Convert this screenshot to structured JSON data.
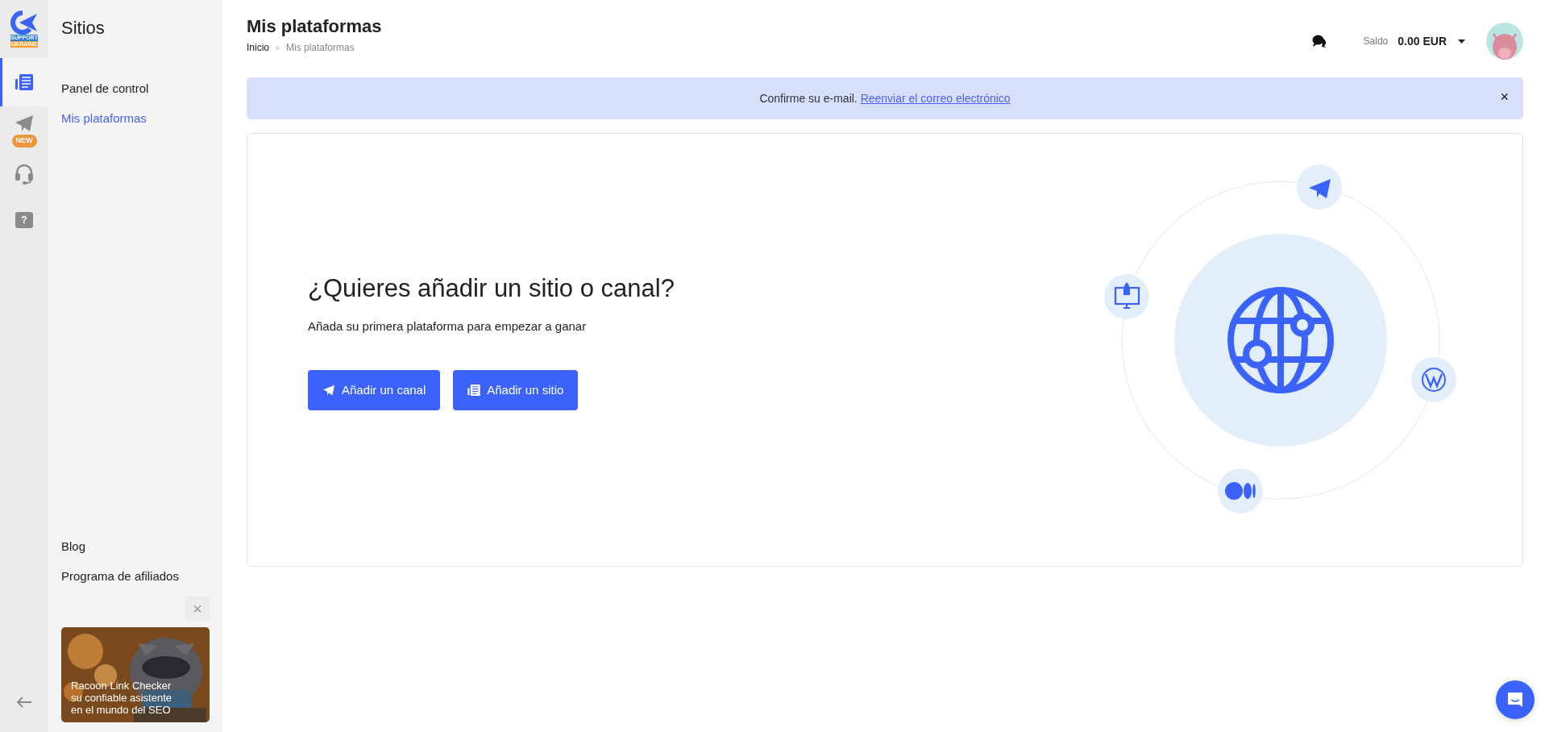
{
  "logo": {
    "badge_top": "SUPPORT",
    "badge_bottom": "UKRAINE"
  },
  "rail": [
    {
      "kind": "sites",
      "selected": true
    },
    {
      "kind": "telegram",
      "selected": false,
      "badge": "NEW"
    },
    {
      "kind": "support",
      "selected": false
    },
    {
      "kind": "help",
      "selected": false,
      "glyph": "?"
    }
  ],
  "sidebar": {
    "title": "Sitios",
    "items": [
      {
        "label": "Panel de control",
        "selected": false
      },
      {
        "label": "Mis plataformas",
        "selected": true
      }
    ],
    "footer_items": [
      {
        "label": "Blog"
      },
      {
        "label": "Programa de afiliados"
      }
    ],
    "promo": {
      "kind": "picture",
      "close": "×",
      "lines": [
        "Racoon Link Checker",
        "su confiable asistente",
        "en el mundo del SEO"
      ]
    }
  },
  "header": {
    "title": "Mis plataformas",
    "breadcrumb": [
      {
        "label": "Inicio",
        "current": false
      },
      {
        "label": "Mis plataformas",
        "current": true
      }
    ],
    "balance_label": "Saldo",
    "balance": "0.00 EUR"
  },
  "alert": {
    "close": "×",
    "text": "Confirme su e-mail.",
    "link": "Reenviar el correo electrónico"
  },
  "empty_state": {
    "heading": "¿Quieres añadir un sitio o canal?",
    "subtext": "Añada su primera plataforma para empezar a ganar",
    "buttons": [
      {
        "kind": "channel",
        "label": "Añadir un canal"
      },
      {
        "kind": "site",
        "label": "Añadir un sitio"
      }
    ]
  }
}
